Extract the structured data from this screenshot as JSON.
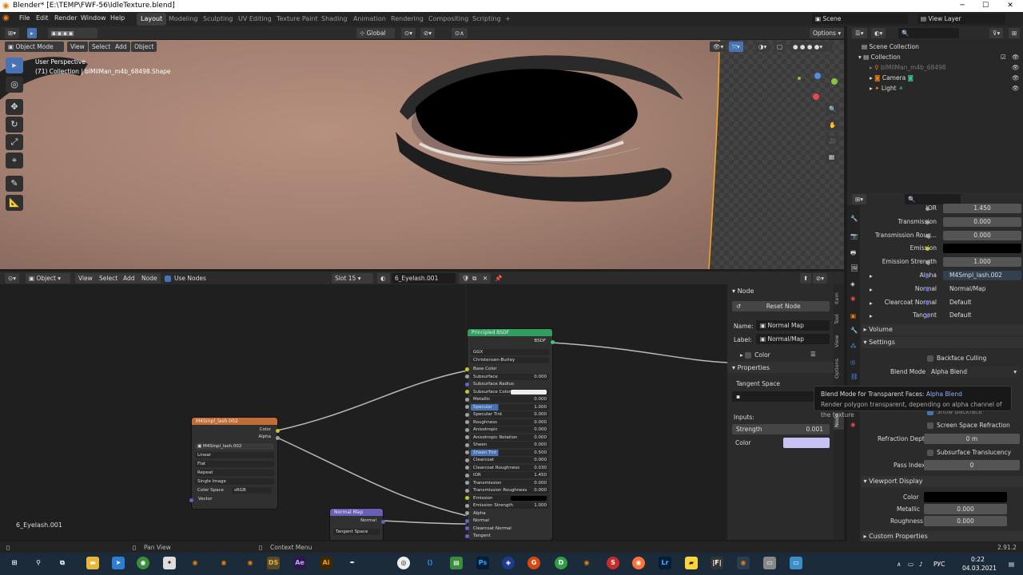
{
  "window": {
    "title": "Blender* [E:\\TEMP\\FWF-56\\IdleTexture.blend]",
    "minimize": "─",
    "maximize": "☐",
    "close": "✕"
  },
  "menu": [
    "File",
    "Edit",
    "Render",
    "Window",
    "Help"
  ],
  "workspaces": [
    "Layout",
    "Modeling",
    "Sculpting",
    "UV Editing",
    "Texture Paint",
    "Shading",
    "Animation",
    "Rendering",
    "Compositing",
    "Scripting",
    "+"
  ],
  "scene": "Scene",
  "view_layer": "View Layer",
  "viewport": {
    "header": {
      "transform": "Global",
      "options": "Options"
    },
    "mode": "Object Mode",
    "menus": [
      "View",
      "Select",
      "Add",
      "Object"
    ],
    "perspective": "User Perspective",
    "collection_info": "(71) Collection | blMilMan_m4b_68498.Shape"
  },
  "node_editor": {
    "header": {
      "type": "Object",
      "menus": [
        "View",
        "Select",
        "Add",
        "Node"
      ],
      "use_nodes": "Use Nodes",
      "slot": "Slot 15",
      "material": "6_Eyelash.001"
    },
    "material_label": "6_Eyelash.001",
    "image_node": {
      "title": "M4Smpl_lash.002",
      "outputs": [
        "Color",
        "Alpha"
      ],
      "image": "M4Smpl_lash.002",
      "options": [
        "Linear",
        "Flat",
        "Repeat",
        "Single Image"
      ],
      "color_space_label": "Color Space",
      "color_space": "sRGB",
      "input": "Vector"
    },
    "normal_node": {
      "title": "Normal Map",
      "output": "Normal",
      "space": "Tangent Space"
    },
    "bsdf_node": {
      "title": "Principled BSDF",
      "output": "BSDF",
      "dists": [
        "GGX",
        "Christensen-Burley"
      ],
      "rows": [
        {
          "l": "Base Color",
          "v": ""
        },
        {
          "l": "Subsurface",
          "v": "0.000"
        },
        {
          "l": "Subsurface Radius",
          "v": ""
        },
        {
          "l": "Subsurface Color",
          "v": ""
        },
        {
          "l": "Metallic",
          "v": "0.000"
        },
        {
          "l": "Specular",
          "v": "1.000"
        },
        {
          "l": "Specular Tint",
          "v": "0.000"
        },
        {
          "l": "Roughness",
          "v": "0.000"
        },
        {
          "l": "Anisotropic",
          "v": "0.000"
        },
        {
          "l": "Anisotropic Rotation",
          "v": "0.000"
        },
        {
          "l": "Sheen",
          "v": "0.000"
        },
        {
          "l": "Sheen Tint",
          "v": "0.500"
        },
        {
          "l": "Clearcoat",
          "v": "0.000"
        },
        {
          "l": "Clearcoat Roughness",
          "v": "0.030"
        },
        {
          "l": "IOR",
          "v": "1.450"
        },
        {
          "l": "Transmission",
          "v": "0.000"
        },
        {
          "l": "Transmission Roughness",
          "v": "0.000"
        },
        {
          "l": "Emission",
          "v": ""
        },
        {
          "l": "Emission Strength",
          "v": "1.000"
        },
        {
          "l": "Alpha",
          "v": ""
        },
        {
          "l": "Normal",
          "v": ""
        },
        {
          "l": "Clearcoat Normal",
          "v": ""
        },
        {
          "l": "Tangent",
          "v": ""
        }
      ]
    }
  },
  "npanel": {
    "section": "Node",
    "reset": "Reset Node",
    "name_label": "Name:",
    "name": "Normal Map",
    "label_label": "Label:",
    "label": "Normal/Map",
    "color": "Color",
    "properties": "Properties",
    "space": "Tangent Space",
    "inputs": "Inputs:",
    "strength_label": "Strength",
    "strength": "0.001",
    "color_label": "Color",
    "tabs": [
      "Item",
      "Tool",
      "View",
      "Options",
      "Node"
    ]
  },
  "outliner": {
    "scene_collection": "Scene Collection",
    "collection": "Collection",
    "items": [
      "blMilMan_m4b_68498",
      "Camera",
      "Light"
    ]
  },
  "properties": {
    "rows": [
      {
        "l": "IOR",
        "v": "1.450"
      },
      {
        "l": "Transmission",
        "v": "0.000"
      },
      {
        "l": "Transmission Roug...",
        "v": "0.000"
      },
      {
        "l": "Emission",
        "v": ""
      },
      {
        "l": "Emission Strength",
        "v": "1.000"
      },
      {
        "l": "Alpha",
        "v": "M4Smpl_lash.002"
      },
      {
        "l": "Normal",
        "v": "Normal/Map"
      },
      {
        "l": "Clearcoat Normal",
        "v": "Default"
      },
      {
        "l": "Tangent",
        "v": "Default"
      }
    ],
    "volume": "Volume",
    "settings": "Settings",
    "backface": "Backface Culling",
    "blend_label": "Blend Mode",
    "blend": "Alpha Blend",
    "show_backface": "Show Backface",
    "ssr": "Screen Space Refraction",
    "refr_label": "Refraction Depth",
    "refr": "0 m",
    "sst": "Subsurface Translucency",
    "pass_label": "Pass Index",
    "pass": "0",
    "viewport_display": "Viewport Display",
    "vd_color": "Color",
    "vd_metallic": "Metallic",
    "vd_metallic_v": "0.000",
    "vd_rough": "Roughness",
    "vd_rough_v": "0.000",
    "custom": "Custom Properties"
  },
  "tooltip": {
    "line1": "Blend Mode for Transparent Faces:",
    "line1b": "Alpha Blend",
    "line2": "Render polygon transparent, depending on alpha channel of the texture"
  },
  "status": {
    "pan": "Pan View",
    "context": "Context Menu",
    "version": "2.91.2"
  },
  "taskbar": {
    "lang": "РУС",
    "time": "0:22",
    "date": "04.03.2021"
  },
  "colors": {
    "accent": "#4772b3",
    "orange": "#f5a623",
    "image_node": "#c26d36",
    "bsdf_node": "#2f9e5f",
    "normal_node": "#6a5fb6"
  }
}
